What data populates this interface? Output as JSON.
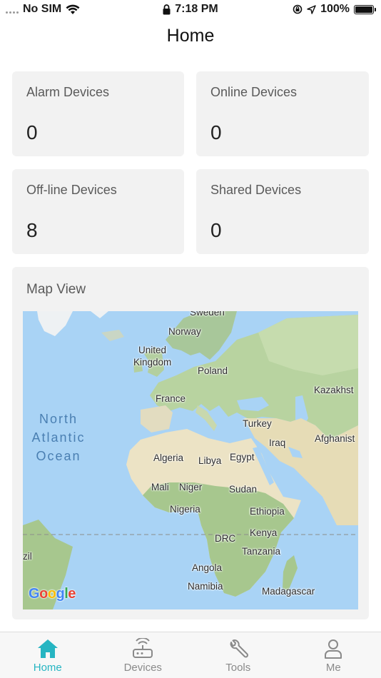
{
  "status_bar": {
    "carrier": "No SIM",
    "time": "7:18 PM",
    "battery": "100%"
  },
  "header": {
    "title": "Home"
  },
  "stats": [
    {
      "label": "Alarm Devices",
      "value": "0"
    },
    {
      "label": "Online Devices",
      "value": "0"
    },
    {
      "label": "Off-line Devices",
      "value": "8"
    },
    {
      "label": "Shared Devices",
      "value": "0"
    }
  ],
  "map": {
    "title": "Map View",
    "ocean_label": [
      "North",
      "Atlantic",
      "Ocean"
    ],
    "places": [
      "Sweden",
      "Norway",
      "United",
      "Kingdom",
      "Poland",
      "France",
      "Kazakhst",
      "Turkey",
      "Iraq",
      "Afghanist",
      "Algeria",
      "Libya",
      "Egypt",
      "Mali",
      "Niger",
      "Sudan",
      "Nigeria",
      "Ethiopia",
      "DRC",
      "Kenya",
      "Tanzania",
      "zil",
      "Angola",
      "Namibia",
      "Madagascar"
    ],
    "attribution": "Google"
  },
  "tabs": [
    {
      "label": "Home",
      "icon": "home-icon",
      "active": true
    },
    {
      "label": "Devices",
      "icon": "router-icon",
      "active": false
    },
    {
      "label": "Tools",
      "icon": "wrench-icon",
      "active": false
    },
    {
      "label": "Me",
      "icon": "person-icon",
      "active": false
    }
  ],
  "colors": {
    "accent": "#26b5c2",
    "card_bg": "#f2f2f2",
    "water": "#a9d3f5"
  }
}
